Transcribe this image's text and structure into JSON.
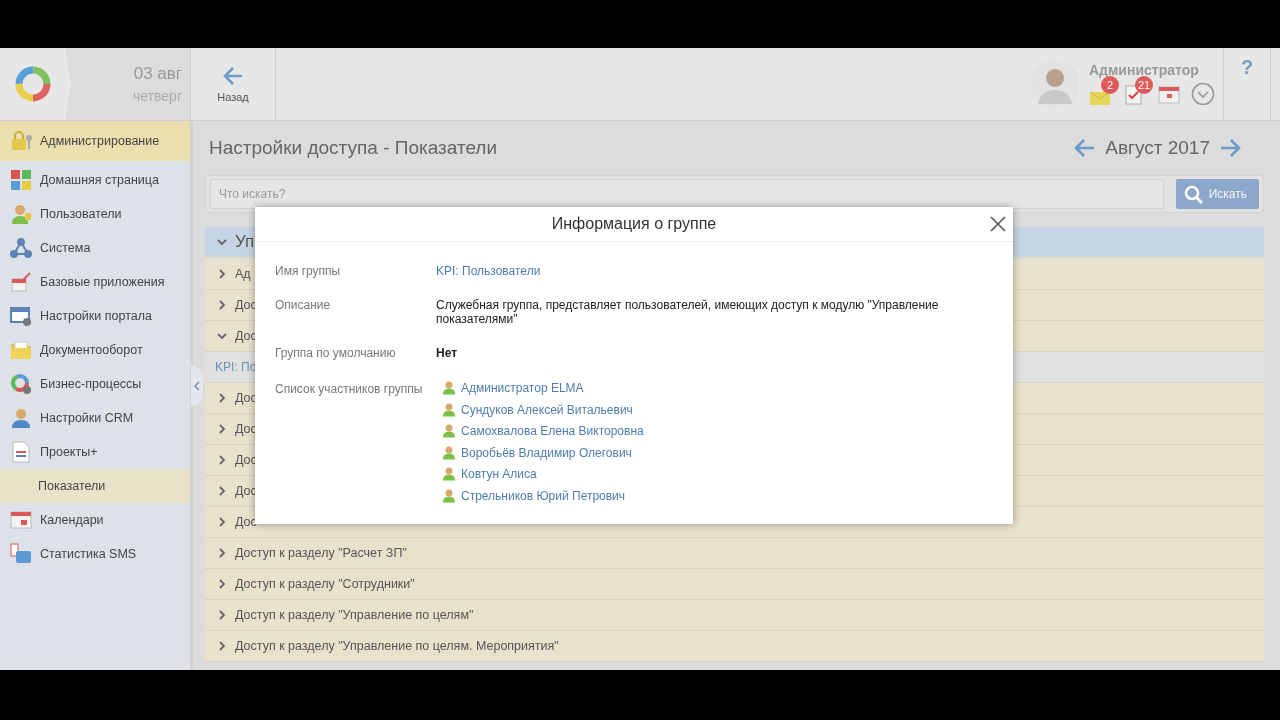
{
  "header": {
    "date": "03 авг",
    "weekday": "четверг",
    "back_label": "Назад",
    "user_name": "Администратор",
    "notifications": [
      {
        "kind": "mail",
        "count": "2"
      },
      {
        "kind": "tasks",
        "count": "21"
      },
      {
        "kind": "calendar"
      },
      {
        "kind": "menu"
      }
    ],
    "help": "?"
  },
  "sidebar": {
    "items": [
      {
        "label": "Администрирование",
        "kind": "section",
        "selected": false
      },
      {
        "label": "Домашняя страница",
        "kind": "item",
        "selected": false
      },
      {
        "label": "Пользователи",
        "kind": "item",
        "selected": false
      },
      {
        "label": "Система",
        "kind": "item",
        "selected": false
      },
      {
        "label": "Базовые приложения",
        "kind": "item",
        "selected": false
      },
      {
        "label": "Настройки портала",
        "kind": "item",
        "selected": false
      },
      {
        "label": "Документооборот",
        "kind": "item",
        "selected": false
      },
      {
        "label": "Бизнес-процессы",
        "kind": "item",
        "selected": false
      },
      {
        "label": "Настройки CRM",
        "kind": "item",
        "selected": false
      },
      {
        "label": "Проекты+",
        "kind": "item",
        "selected": false
      },
      {
        "label": "Показатели",
        "kind": "subitem",
        "selected": true
      },
      {
        "label": "Календари",
        "kind": "item",
        "selected": false
      },
      {
        "label": "Статистика SMS",
        "kind": "item",
        "selected": false
      }
    ]
  },
  "page": {
    "title": "Настройки доступа - Показатели",
    "period": "Август 2017",
    "search": {
      "placeholder": "Что искать?",
      "button": "Искать"
    },
    "rows": [
      {
        "kind": "group",
        "text": "Уп",
        "expanded": true
      },
      {
        "kind": "row",
        "text": "Ад",
        "expanded": false
      },
      {
        "kind": "row",
        "text": "Дос",
        "expanded": false
      },
      {
        "kind": "row",
        "text": "Дос",
        "expanded": true
      },
      {
        "kind": "link",
        "text": "KPI: По"
      },
      {
        "kind": "row",
        "text": "Дос",
        "expanded": false
      },
      {
        "kind": "row",
        "text": "Дос",
        "expanded": false
      },
      {
        "kind": "row",
        "text": "Дос",
        "expanded": false
      },
      {
        "kind": "row",
        "text": "Дос",
        "expanded": false
      },
      {
        "kind": "row",
        "text": "Дос",
        "expanded": false
      },
      {
        "kind": "row",
        "text": "Доступ к разделу \"Расчет ЗП\"",
        "expanded": false
      },
      {
        "kind": "row",
        "text": "Доступ к разделу \"Сотрудники\"",
        "expanded": false
      },
      {
        "kind": "row",
        "text": "Доступ к разделу \"Управление по целям\"",
        "expanded": false
      },
      {
        "kind": "row",
        "text": "Доступ к разделу \"Управление по целям. Мероприятия\"",
        "expanded": false
      }
    ]
  },
  "dialog": {
    "title": "Информация о группе",
    "fields": [
      {
        "kind": "link",
        "label": "Имя группы",
        "value": "KPI: Пользователи"
      },
      {
        "kind": "text",
        "label": "Описание",
        "value": "Служебная группа, представляет пользователей, имеющих доступ к модулю \"Управление показателями\""
      },
      {
        "kind": "bold",
        "label": "Группа по умолчанию",
        "value": "Нет"
      },
      {
        "kind": "members",
        "label": "Список участников группы",
        "members": [
          "Администратор ELMA",
          "Сундуков Алексей Витальевич",
          "Самохвалова Елена Викторовна",
          "Воробьёв Владимир Олегович",
          "Ковтун Алиса",
          "Стрельников Юрий Петрович"
        ]
      }
    ]
  }
}
